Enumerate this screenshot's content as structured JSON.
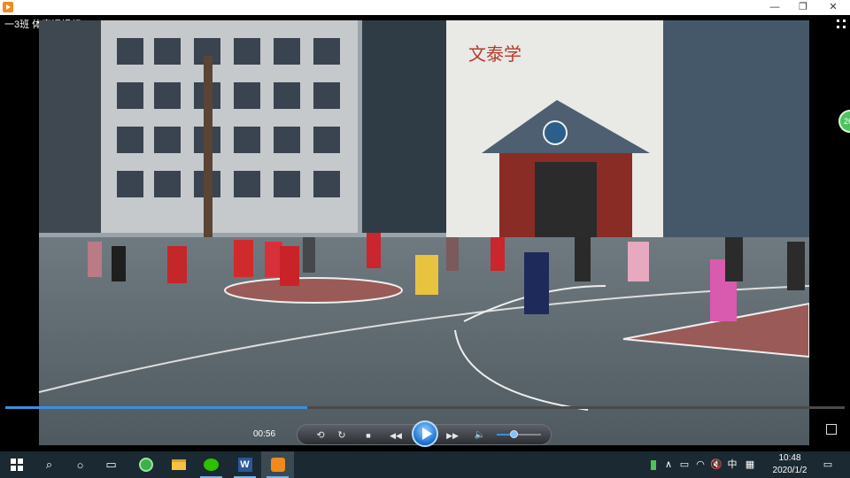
{
  "window": {
    "title_bar_icon": "video-player-icon",
    "minimize_label": "—",
    "maximize_label": "❐",
    "close_label": "✕"
  },
  "player": {
    "video_title": "一3班 体育课视频",
    "side_badge": "26",
    "elapsed_time": "00:56",
    "progress_fraction": 0.36,
    "volume_fraction": 0.38,
    "accent_color": "#3b8ee0"
  },
  "controls": {
    "repeat_icon": "⟲",
    "refresh_icon": "↻",
    "stop_icon": "■",
    "prev_icon": "◀◀",
    "next_icon": "▶▶",
    "volume_icon": "🔈"
  },
  "scene": {
    "building_sign": "文泰学"
  },
  "taskbar": {
    "start_icon": "windows-logo-icon",
    "search_icon": "⌕",
    "cortana_icon": "○",
    "taskview_icon": "▭",
    "apps": [
      "browser-icon",
      "file-explorer-icon",
      "wechat-icon",
      "word-icon",
      "video-player-icon"
    ],
    "word_label": "W",
    "tray_ime": "中",
    "clock_time": "10:48",
    "clock_date": "2020/1/2"
  }
}
